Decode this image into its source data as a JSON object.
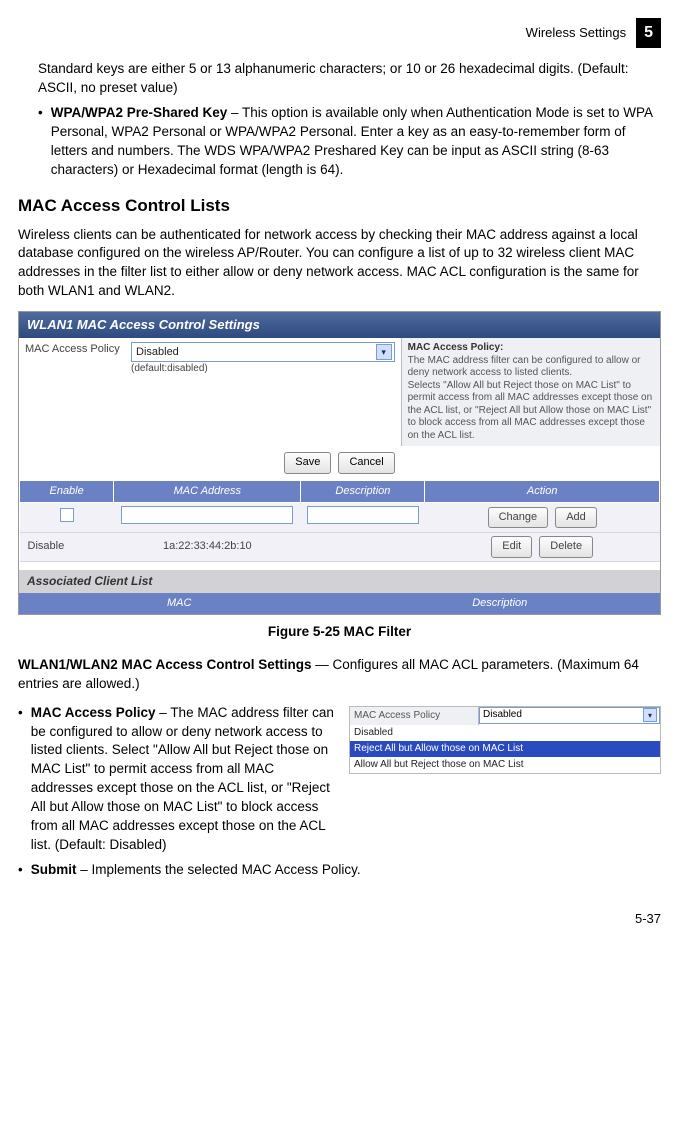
{
  "header": {
    "section": "Wireless Settings",
    "chapter": "5"
  },
  "intro": {
    "p1": "Standard keys are either 5 or 13 alphanumeric characters; or 10 or 26 hexadecimal digits. (Default: ASCII, no preset value)",
    "b1_term": "WPA/WPA2 Pre-Shared Key",
    "b1_text": " – This option is available only when Authentication Mode is set to WPA Personal, WPA2 Personal or WPA/WPA2 Personal. Enter a key as an easy-to-remember form of letters and numbers. The WDS WPA/WPA2 Preshared Key can be input as ASCII string (8-63 characters) or Hexadecimal format (length is 64)."
  },
  "section": {
    "title": "MAC Access Control Lists",
    "para": "Wireless clients can be authenticated for network access by checking their MAC address against a local database configured on the wireless AP/Router. You can configure a list of up to 32 wireless client MAC addresses in the filter list to either allow or deny network access. MAC ACL configuration is the same for both WLAN1 and WLAN2."
  },
  "screenshot": {
    "title": "WLAN1 MAC Access Control Settings",
    "policy_label": "MAC Access Policy",
    "policy_value": "Disabled",
    "policy_default": "(default:disabled)",
    "help_title": "MAC Access Policy:",
    "help_text": "The MAC address filter can be configured to allow or deny network access to listed clients.\nSelects \"Allow All but Reject those on MAC List\" to permit access from all MAC addresses except those on the ACL list, or \"Reject All but Allow those on MAC List\" to block access from all MAC addresses except those on the ACL list.",
    "btn_save": "Save",
    "btn_cancel": "Cancel",
    "cols": {
      "enable": "Enable",
      "mac": "MAC Address",
      "desc": "Description",
      "action": "Action"
    },
    "btn_change": "Change",
    "btn_add": "Add",
    "btn_edit": "Edit",
    "btn_delete": "Delete",
    "row2": {
      "enable": "Disable",
      "mac": "1a:22:33:44:2b:10"
    },
    "assoc_title": "Associated Client List",
    "assoc_cols": {
      "mac": "MAC",
      "desc": "Description"
    }
  },
  "figure": {
    "caption": "Figure 5-25  MAC Filter"
  },
  "settings": {
    "lead_term": "WLAN1/WLAN2 MAC Access Control Settings",
    "lead_text": " — Configures all MAC ACL parameters. (Maximum 64 entries are allowed.)",
    "b1_term": "MAC Access Policy",
    "b1_text": " – The MAC address filter can be configured to allow or deny network access to listed clients. Select \"Allow All but Reject those on MAC List\" to permit access from all MAC addresses except those on the ACL list, or \"Reject All but Allow those on MAC List\" to block access from all MAC addresses except those on the ACL list. (Default: Disabled)",
    "b2_term": "Submit",
    "b2_text": " – Implements the selected MAC Access Policy."
  },
  "dropdown": {
    "label": "MAC Access Policy",
    "selected": "Disabled",
    "opts": [
      "Disabled",
      "Reject All but Allow those on MAC List",
      "Allow All but Reject those on MAC List"
    ]
  },
  "footer": {
    "page": "5-37"
  }
}
